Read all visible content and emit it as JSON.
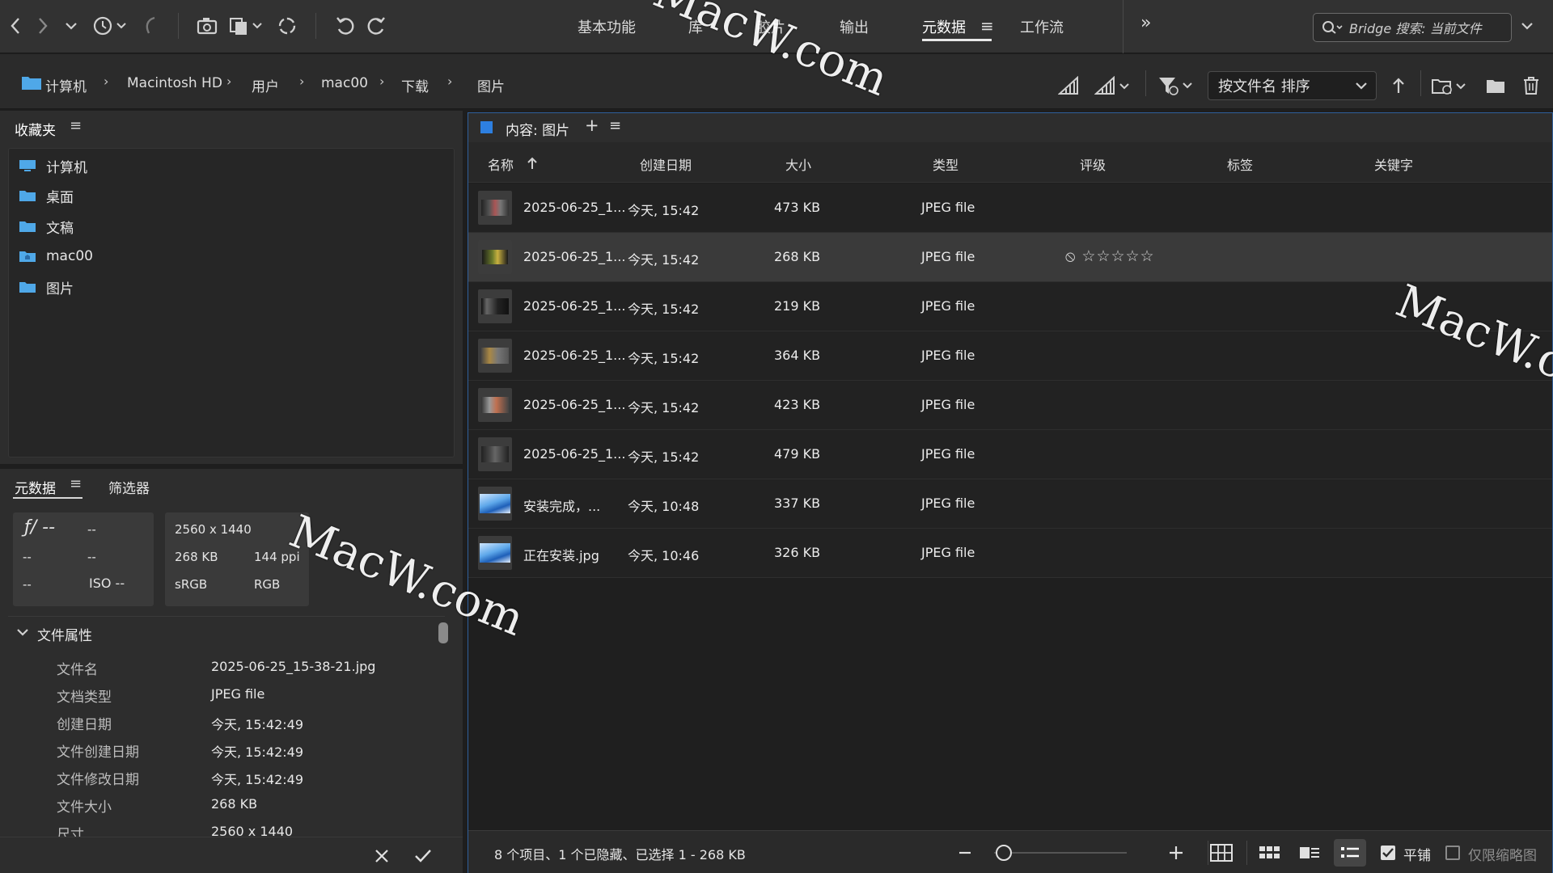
{
  "toolbar": {
    "workspaces": [
      {
        "label": "基本功能"
      },
      {
        "label": "库"
      },
      {
        "label": "胶片"
      },
      {
        "label": "输出"
      },
      {
        "label": "元数据"
      },
      {
        "label": "工作流"
      }
    ],
    "active_workspace": "元数据",
    "search_placeholder": "Bridge 搜索: 当前文件"
  },
  "path": {
    "crumbs": [
      "计算机",
      "Macintosh HD",
      "用户",
      "mac00",
      "下载",
      "图片"
    ],
    "sort_label": "按文件名 排序"
  },
  "favorites": {
    "title": "收藏夹",
    "items": [
      "计算机",
      "桌面",
      "文稿",
      "mac00",
      "图片"
    ]
  },
  "metadata_panel": {
    "tabs": [
      "元数据",
      "筛选器"
    ],
    "camera": {
      "fstop": "ƒ/ --",
      "shutter": "--",
      "r2a": "--",
      "r2b": "--",
      "r3a": "--",
      "iso": "ISO --"
    },
    "image": {
      "dimensions": "2560 x 1440",
      "size": "268 KB",
      "ppi": "144 ppi",
      "profile": "sRGB",
      "mode": "RGB"
    },
    "section_title": "文件属性",
    "props": [
      {
        "label": "文件名",
        "value": "2025-06-25_15-38-21.jpg"
      },
      {
        "label": "文档类型",
        "value": "JPEG file"
      },
      {
        "label": "创建日期",
        "value": "今天, 15:42:49"
      },
      {
        "label": "文件创建日期",
        "value": "今天, 15:42:49"
      },
      {
        "label": "文件修改日期",
        "value": "今天, 15:42:49"
      },
      {
        "label": "文件大小",
        "value": "268 KB"
      },
      {
        "label": "尺寸",
        "value": "2560 x 1440"
      }
    ]
  },
  "content": {
    "title": "内容: 图片",
    "columns": [
      "名称",
      "创建日期",
      "大小",
      "类型",
      "评级",
      "标签",
      "关键字"
    ],
    "rows": [
      {
        "name": "2025-06-25_1...",
        "date": "今天, 15:42",
        "size": "473 KB",
        "type": "JPEG file"
      },
      {
        "name": "2025-06-25_1...",
        "date": "今天, 15:42",
        "size": "268 KB",
        "type": "JPEG file",
        "selected": true
      },
      {
        "name": "2025-06-25_1...",
        "date": "今天, 15:42",
        "size": "219 KB",
        "type": "JPEG file"
      },
      {
        "name": "2025-06-25_1...",
        "date": "今天, 15:42",
        "size": "364 KB",
        "type": "JPEG file"
      },
      {
        "name": "2025-06-25_1...",
        "date": "今天, 15:42",
        "size": "423 KB",
        "type": "JPEG file"
      },
      {
        "name": "2025-06-25_1...",
        "date": "今天, 15:42",
        "size": "479 KB",
        "type": "JPEG file"
      },
      {
        "name": "安装完成，...",
        "date": "今天, 10:48",
        "size": "337 KB",
        "type": "JPEG file"
      },
      {
        "name": "正在安装.jpg",
        "date": "今天, 10:46",
        "size": "326 KB",
        "type": "JPEG file"
      }
    ],
    "rating_display": "⦸ ☆☆☆☆☆",
    "status": "8 个项目、1 个已隐藏、已选择 1 - 268 KB",
    "tile_label": "平铺",
    "thumbs_only_label": "仅限缩略图"
  },
  "watermark": "MacW.com"
}
